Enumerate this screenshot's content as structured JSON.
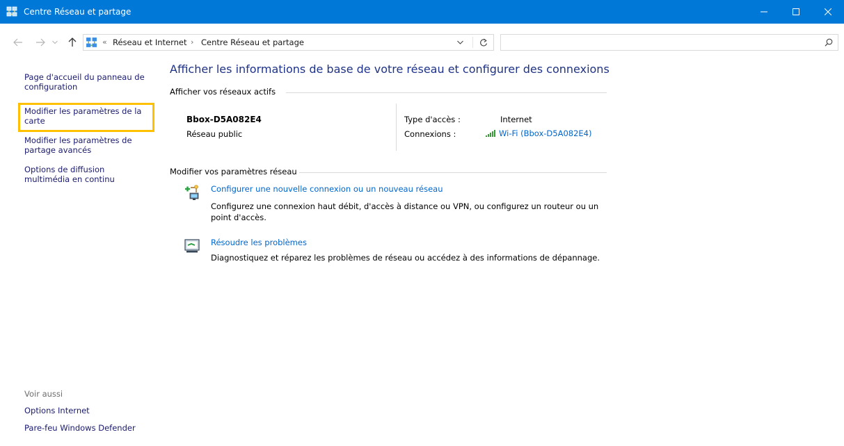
{
  "window": {
    "title": "Centre Réseau et partage",
    "titlebar_color": "#0078d7"
  },
  "navigation": {
    "back_icon": "arrow-left-icon",
    "forward_icon": "arrow-right-icon",
    "recent_icon": "chevron-down-icon",
    "up_icon": "arrow-up-icon",
    "breadcrumb_overflow": "«",
    "breadcrumbs": [
      "Réseau et Internet",
      "Centre Réseau et partage"
    ],
    "breadcrumb_separator": "›",
    "search_placeholder": ""
  },
  "sidebar": {
    "links": [
      "Page d'accueil du panneau de configuration",
      "Modifier les paramètres de la carte",
      "Modifier les paramètres de partage avancés",
      "Options de diffusion multimédia en continu"
    ],
    "highlight_color": "#ffc000",
    "see_also": {
      "title": "Voir aussi",
      "links": [
        "Options Internet",
        "Pare-feu Windows Defender"
      ]
    }
  },
  "main": {
    "title": "Afficher les informations de base de votre réseau et configurer des connexions",
    "active_networks": {
      "header": "Afficher vos réseaux actifs",
      "network_name": "Bbox-D5A082E4",
      "network_type": "Réseau public",
      "access_type_label": "Type d'accès :",
      "access_type_value": "Internet",
      "connections_label": "Connexions :",
      "connection_value": "Wi-Fi (Bbox-D5A082E4)"
    },
    "change_settings": {
      "header": "Modifier vos paramètres réseau",
      "tasks": [
        {
          "link": "Configurer une nouvelle connexion ou un nouveau réseau",
          "description": "Configurez une connexion haut débit, d'accès à distance ou VPN, ou configurez un routeur ou un point d'accès.",
          "icon": "new-connection-icon"
        },
        {
          "link": "Résoudre les problèmes",
          "description": "Diagnostiquez et réparez les problèmes de réseau ou accédez à des informations de dépannage.",
          "icon": "troubleshoot-icon"
        }
      ]
    }
  },
  "colors": {
    "link": "#0066cc",
    "sidebar_link": "#1a1a6e",
    "title": "#1e3287"
  }
}
